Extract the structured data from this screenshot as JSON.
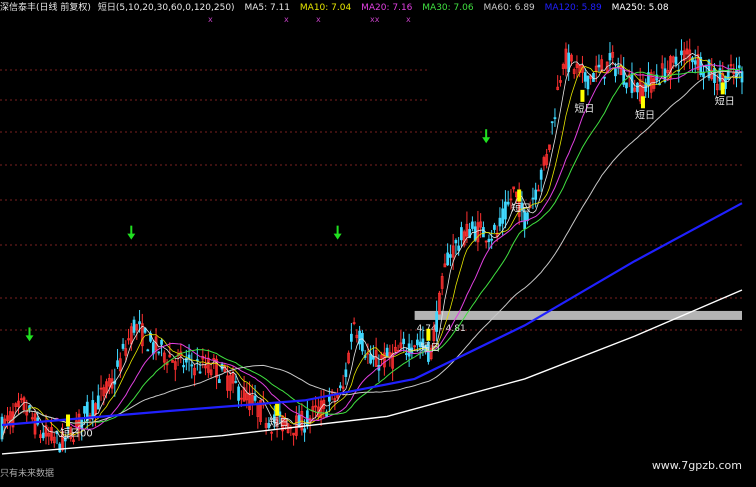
{
  "legend": {
    "title": "深信泰丰(日线 前复权)",
    "indicator": "短日(5,10,20,30,60,0,120,250)",
    "items": [
      {
        "label": "MA5: 7.11",
        "color": "#e6e6e6"
      },
      {
        "label": "MA10: 7.04",
        "color": "#e6e600"
      },
      {
        "label": "MA20: 7.16",
        "color": "#e040e0"
      },
      {
        "label": "MA30: 7.06",
        "color": "#40e040"
      },
      {
        "label": "MA60: 6.89",
        "color": "#c8c8c8"
      },
      {
        "label": "MA120: 5.89",
        "color": "#2020ff"
      },
      {
        "label": "MA250: 5.08",
        "color": "#ffffff"
      }
    ]
  },
  "marks": [
    "x",
    "x",
    "x",
    "xx",
    "x"
  ],
  "watermark": "www.7gpzb.com",
  "bottom_note": "只有未来数据",
  "chart_data": {
    "type": "candlestick",
    "title": "深信泰丰(日线 前复权)",
    "ylim": [
      3.4,
      7.6
    ],
    "price_band": {
      "label": "4.74 - 4.81",
      "low": 4.74,
      "high": 4.81
    },
    "signal_label": "短日",
    "signals": [
      {
        "i": 10,
        "arrow": "down",
        "price": 4.6
      },
      {
        "i": 47,
        "arrow": "down",
        "price": 5.55
      },
      {
        "i": 122,
        "arrow": "down",
        "price": 5.55
      },
      {
        "i": 176,
        "arrow": "down",
        "price": 6.45
      }
    ],
    "short_day_labels": [
      {
        "i": 24,
        "price": 3.75,
        "text": "短日00"
      },
      {
        "i": 100,
        "price": 3.85,
        "text": "短日"
      },
      {
        "i": 155,
        "price": 4.55,
        "text": "短日"
      },
      {
        "i": 188,
        "price": 5.85,
        "text": "短日"
      },
      {
        "i": 211,
        "price": 6.78,
        "text": "短日"
      },
      {
        "i": 233,
        "price": 6.72,
        "text": "短日"
      },
      {
        "i": 262,
        "price": 6.85,
        "text": "短日"
      }
    ]
  }
}
